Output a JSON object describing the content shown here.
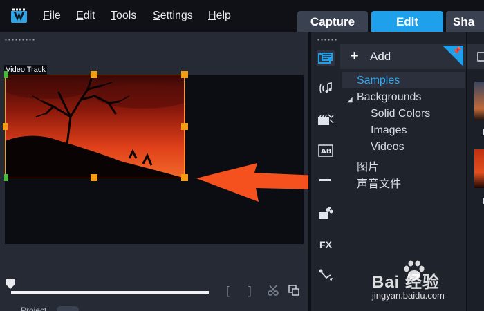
{
  "menu": {
    "items": [
      {
        "underlined": "F",
        "rest": "ile"
      },
      {
        "underlined": "E",
        "rest": "dit"
      },
      {
        "underlined": "T",
        "rest": "ools"
      },
      {
        "underlined": "S",
        "rest": "ettings"
      },
      {
        "underlined": "H",
        "rest": "elp"
      }
    ]
  },
  "tabs": {
    "capture": "Capture",
    "edit": "Edit",
    "share": "Sha"
  },
  "preview": {
    "track_label": "Video Track"
  },
  "playback": {
    "mark_in": "[",
    "mark_out": "]",
    "project_label": "Project"
  },
  "library": {
    "add_label": "Add",
    "tree": [
      {
        "label": "Samples",
        "selected": true
      },
      {
        "label": "Backgrounds",
        "expanded": true
      },
      {
        "label": "Solid Colors"
      },
      {
        "label": "Images"
      },
      {
        "label": "Videos"
      },
      {
        "label": "图片"
      },
      {
        "label": "声音文件"
      }
    ],
    "side_icons": [
      "media-icon",
      "audio-effects-icon",
      "transitions-icon",
      "titles-icon",
      "graphics-icon",
      "filters-icon",
      "fx-icon",
      "motion-path-icon"
    ],
    "fx_label": "FX"
  },
  "thumbnails": {
    "labels": [
      "B",
      "B"
    ]
  },
  "watermark": {
    "brand": "Bai 经验",
    "url": "jingyan.baidu.com"
  },
  "colors": {
    "accent": "#1ea0ea",
    "selection": "#f39c12",
    "arrow": "#f4511e"
  }
}
